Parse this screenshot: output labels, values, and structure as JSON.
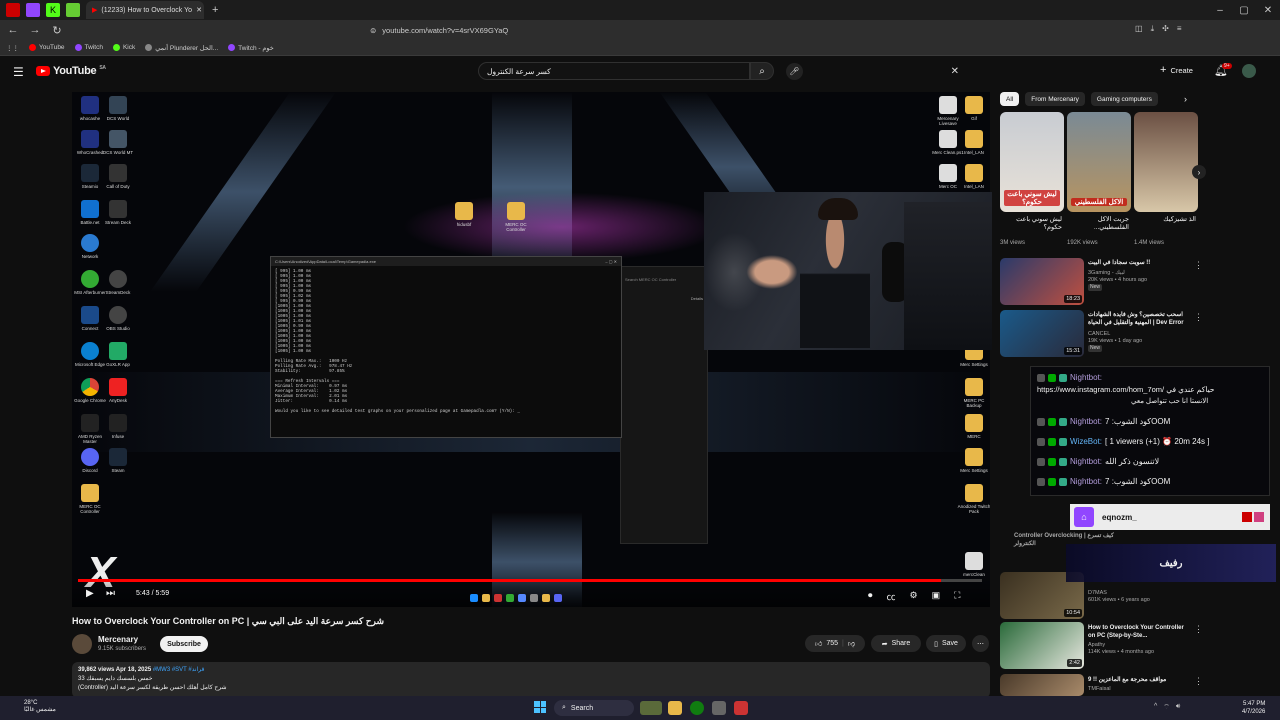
{
  "browser": {
    "active_tab_title": "(12233) How to Overclock Yo",
    "url": "youtube.com/watch?v=4srVX69GYaQ",
    "bookmarks": [
      "YouTube",
      "Twitch",
      "Kick",
      "أنمي Plunderer الحل...",
      "Twitch - خوم"
    ]
  },
  "youtube": {
    "logo": "YouTube",
    "region": "SA",
    "search_value": "كسر سرعة الكنترول",
    "create_label": "Create",
    "notif_count": "9+"
  },
  "video": {
    "time": "5:43 / 5:59",
    "progress": 0.955,
    "title": "How to Overclock Your Controller on PC | شرح كسر سرعة اليد على البي سي",
    "channel": "Mercenary",
    "subscribers": "9.15K subscribers",
    "subscribe_label": "Subscribe",
    "likes": "755",
    "share_label": "Share",
    "save_label": "Save",
    "desc_meta": "39,862 views  Apr 18, 2025",
    "desc_tags": "#MW3 #SVT #قراند",
    "desc_line1": "33 خمس بلسسك دايم يسبقك",
    "desc_line2": "(Controller) شرح كامل أهلك احسن طريقة لكسر سرعة اليد",
    "cmd_title": "C:\\Users\\Anodized\\AppData\\Local\\Temp\\Gamepadla.exe",
    "cmd_text": "[ 995] 1.00 ms\n[ 995] 1.00 ms\n[ 995] 1.00 ms\n[ 995] 1.00 ms\n[ 995] 0.99 ms\n[ 995] 1.02 ms\n[ 995] 0.99 ms\n[1005] 1.00 ms\n[1005] 1.00 ms\n[1005] 1.00 ms\n[1005] 1.01 ms\n[1005] 0.99 ms\n[1005] 1.00 ms\n[1005] 1.00 ms\n[1005] 1.00 ms\n[1005] 1.00 ms\n[1005] 1.00 ms\n\nPolling Rate Max.:   1000 Hz\nPolling Rate Avg.:   978.47 Hz\nStability:           97.85%\n\n=== Refresh Intervals ===\nMinimal Interval:    0.97 ms\nAverage Interval:    1.02 ms\nMaximum Interval:    2.01 ms\nJitter:              0.14 ms\n\nWould you like to see detailed test graphs on your personalized page at Gamepadla.com? (Y/N): _"
  },
  "sidebar": {
    "chips": [
      "All",
      "From Mercenary",
      "Gaming computers"
    ],
    "shorts": [
      {
        "title": "ليش سوني باعت حكوم؟",
        "views": "3M views",
        "caption": "ليش سوني باعت حكوم؟"
      },
      {
        "title": "جربت الاكل الفلسطيني...",
        "views": "192K views",
        "caption": "الاكل الفلسطيني"
      },
      {
        "title": "الذ تشيزكيك",
        "views": "1.4M views",
        "caption": ""
      }
    ],
    "recs": [
      {
        "title": "سويت سجادا في البيت !!",
        "channel": "3Gaming - لبيك",
        "meta": "20K views • 4 hours ago",
        "badge": "New",
        "duration": "18:23"
      },
      {
        "title": "اسحب تخصصين؟ وش فايدة الشهادات المهنية والتقليل في الحياة | Dev Error",
        "channel": "CANCEL",
        "meta": "19K views • 1 day ago",
        "badge": "New",
        "duration": "15:31"
      },
      {
        "title": "Controller Overclocking | كيف تسرع الكنترولر",
        "channel": "D7MAS",
        "meta": "601K views • 6 years ago",
        "badge": "",
        "duration": "10:54"
      },
      {
        "title": "How to Overclock Your Controller on PC (Step-by-Ste...",
        "channel": "Apathy",
        "meta": "114K views • 4 months ago",
        "badge": "",
        "duration": "2:42"
      },
      {
        "title": "مواقف محرجة مع الماعزين !! 9",
        "channel": "TMFaisal",
        "meta": "",
        "badge": "",
        "duration": ""
      }
    ]
  },
  "chat": [
    {
      "user": "Nightbot:",
      "msg": "https://www.instagram.com/hom_7om/ حياكم عندي في",
      "msg2": "الانستا انا حب تتواصل معي"
    },
    {
      "user": "Nightbot:",
      "msg": "كود الشوب: 7OOM"
    },
    {
      "user": "WizeBot:",
      "msg": "[ 1 viewers (+1) ⏰ 20m 24s ]"
    },
    {
      "user": "Nightbot:",
      "msg": "لاتنسون ذكر الله"
    },
    {
      "user": "Nightbot:",
      "msg": "كود الشوب: 7OOM"
    }
  ],
  "overlay": {
    "twitch_name": "eqnozm_",
    "rafeeq": "رفيف"
  },
  "taskbar": {
    "search": "Search",
    "weather_temp": "28°C",
    "weather_desc": "مشمس غالبًا",
    "time": "5:47 PM",
    "date": "4/7/2026"
  }
}
